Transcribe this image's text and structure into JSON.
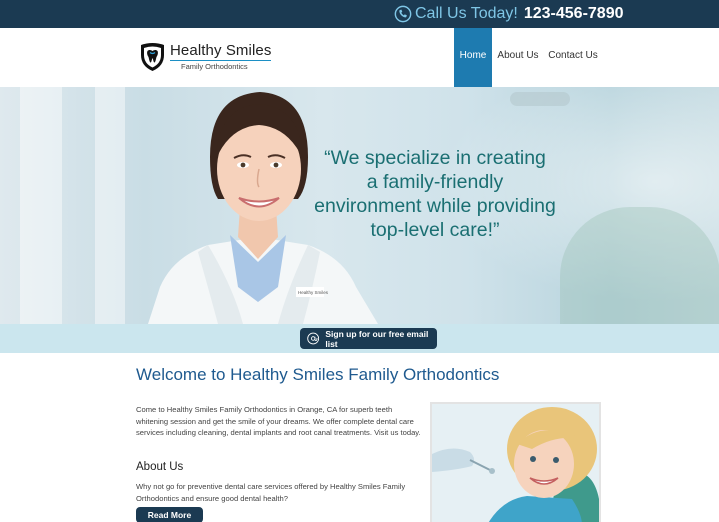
{
  "topbar": {
    "call_label": "Call Us Today!",
    "phone": "123-456-7890",
    "icon": "phone-icon"
  },
  "brand": {
    "name": "Healthy Smiles",
    "tagline": "Family Orthodontics",
    "icon": "tooth-shield-logo"
  },
  "nav": {
    "items": [
      {
        "label": "Home",
        "active": true
      },
      {
        "label": "About Us",
        "active": false
      },
      {
        "label": "Contact Us",
        "active": false
      }
    ]
  },
  "hero": {
    "quote_lines": [
      "“We specialize in creating",
      "a family-friendly",
      "environment while providing",
      "top-level care!”"
    ],
    "badge_text": "Healthy Smiles"
  },
  "email": {
    "button_label": "Sign up for our free email list",
    "icon": "email-at-icon"
  },
  "content": {
    "welcome_title": "Welcome to Healthy Smiles Family Orthodontics",
    "intro": "Come to Healthy Smiles Family Orthodontics in Orange, CA for superb teeth whitening session and get the smile of your dreams. We offer complete dental care services including cleaning, dental implants and root canal treatments. Visit us today.",
    "about_title": "About Us",
    "about_text": "Why not go for preventive dental care services offered by Healthy Smiles Family Orthodontics and ensure good dental health?",
    "read_more": "Read More"
  },
  "colors": {
    "navy": "#1b3a52",
    "accent_blue": "#1e7bb0",
    "quote_teal": "#1a6f72",
    "strip": "#cbe6ee"
  }
}
